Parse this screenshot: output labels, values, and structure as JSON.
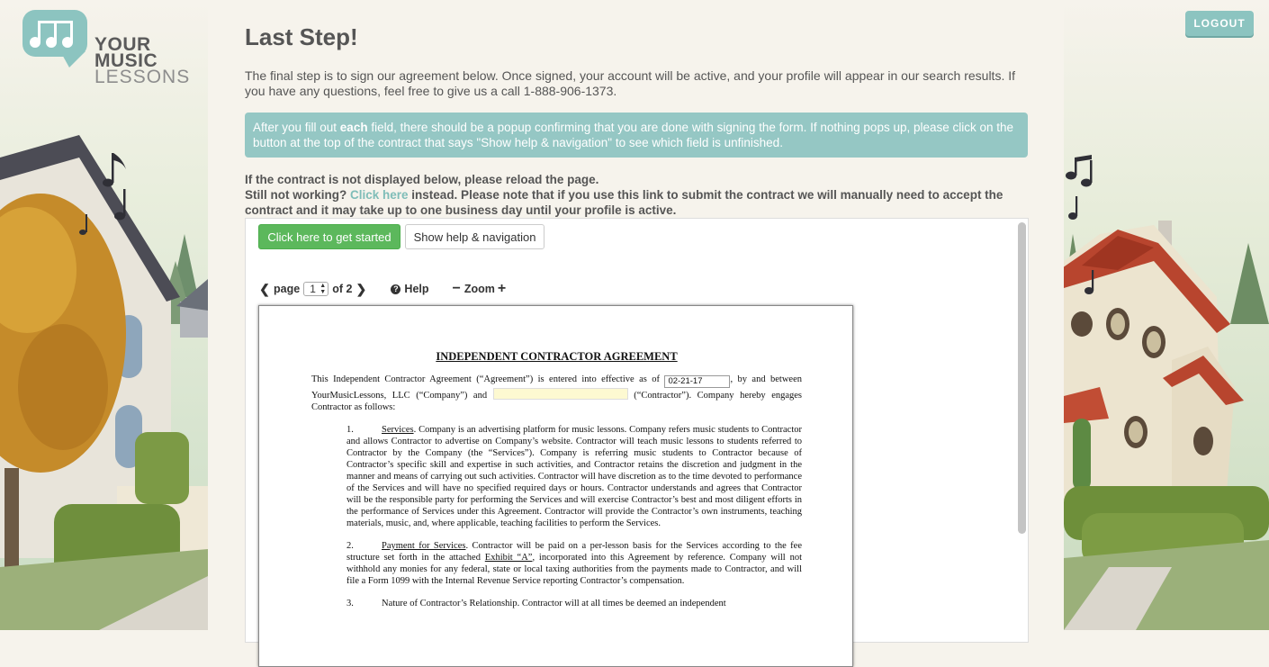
{
  "logo": {
    "line1": "YOUR",
    "line2": "MUSIC",
    "line3": "LESSONS"
  },
  "header": {
    "logout_label": "LOGOUT"
  },
  "page": {
    "title": "Last Step!",
    "intro": "The final step is to sign our agreement below. Once signed, your account will be active, and your profile will appear in our search results. If you have any questions, feel free to give us a call 1-888-906-1373.",
    "alert_pre": "After you fill out ",
    "alert_bold": "each",
    "alert_post": " field, there should be a popup confirming that you are done with signing the form. If nothing pops up, please click on the button at the top of the contract that says \"Show help & navigation\" to see which field is unfinished.",
    "notice_line1": "If the contract is not displayed below, please reload the page.",
    "notice_pre": "Still not working? ",
    "notice_link": "Click here",
    "notice_post": " instead. Please note that if you use this link to submit the contract we will manually need to accept the contract and it may take up to one business day until your profile is active."
  },
  "viewer": {
    "start_label": "Click here to get started",
    "help_nav_label": "Show help & navigation",
    "page_label": "page",
    "page_value": "1",
    "of_label": "of 2",
    "help_label": "Help",
    "zoom_label": "Zoom"
  },
  "document": {
    "title": "INDEPENDENT CONTRACTOR AGREEMENT",
    "intro_pre": "This Independent Contractor Agreement (“Agreement”) is entered into effective as of",
    "date_value": "02-21-17",
    "intro_mid": ", by and between YourMusicLessons, LLC (“Company”) and",
    "intro_post": "(“Contractor”).   Company hereby engages Contractor as follows:",
    "clause1_num": "1.",
    "clause1_title": "Services",
    "clause1_text": ".  Company is an advertising platform for music lessons.  Company refers music students to Contractor and allows Contractor to advertise on Company’s website.  Contractor will teach music lessons to students referred to Contractor by the Company (the “Services”).  Company is referring music students to Contractor because of Contractor’s specific skill and expertise in such activities, and Contractor retains the discretion and judgment in the manner and means of carrying out such activities. Contractor will have discretion as to the time devoted to performance of the Services and will have no specified required days or hours.  Contractor understands and agrees that Contractor will be the responsible party for performing the Services and will exercise Contractor’s best and most diligent efforts in the performance of Services under this Agreement.  Contractor will provide the Contractor’s own instruments, teaching materials, music, and, where applicable, teaching facilities to perform the Services.",
    "clause2_num": "2.",
    "clause2_title": "Payment for Services",
    "clause2_text_pre": ".  Contractor will be paid on a per-lesson basis for the Services according to the fee structure set forth in the attached ",
    "clause2_exhibit": "Exhibit “A”",
    "clause2_text_post": ", incorporated into this Agreement by reference.  Company will not withhold any monies for any federal, state or local taxing authorities from the payments made to Contractor, and will file a Form 1099 with the Internal Revenue Service reporting Contractor’s compensation.",
    "clause3_num": "3.",
    "clause3_text": "Nature of Contractor’s Relationship.  Contractor will at all times be deemed an independent"
  },
  "colors": {
    "accent": "#8cc4c0",
    "alert_bg": "#95c7c4",
    "link": "#7fbdb8",
    "start_button": "#5cb85c"
  }
}
